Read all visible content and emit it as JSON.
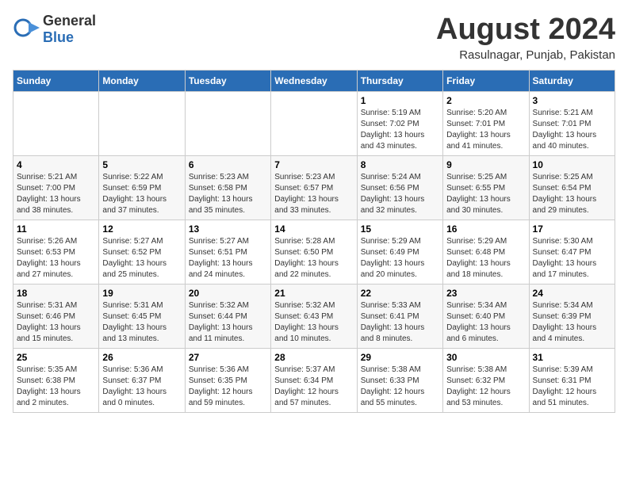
{
  "header": {
    "logo_line1": "General",
    "logo_line2": "Blue",
    "month_title": "August 2024",
    "location": "Rasulnagar, Punjab, Pakistan"
  },
  "calendar": {
    "days_of_week": [
      "Sunday",
      "Monday",
      "Tuesday",
      "Wednesday",
      "Thursday",
      "Friday",
      "Saturday"
    ],
    "weeks": [
      [
        {
          "day": "",
          "info": ""
        },
        {
          "day": "",
          "info": ""
        },
        {
          "day": "",
          "info": ""
        },
        {
          "day": "",
          "info": ""
        },
        {
          "day": "1",
          "info": "Sunrise: 5:19 AM\nSunset: 7:02 PM\nDaylight: 13 hours\nand 43 minutes."
        },
        {
          "day": "2",
          "info": "Sunrise: 5:20 AM\nSunset: 7:01 PM\nDaylight: 13 hours\nand 41 minutes."
        },
        {
          "day": "3",
          "info": "Sunrise: 5:21 AM\nSunset: 7:01 PM\nDaylight: 13 hours\nand 40 minutes."
        }
      ],
      [
        {
          "day": "4",
          "info": "Sunrise: 5:21 AM\nSunset: 7:00 PM\nDaylight: 13 hours\nand 38 minutes."
        },
        {
          "day": "5",
          "info": "Sunrise: 5:22 AM\nSunset: 6:59 PM\nDaylight: 13 hours\nand 37 minutes."
        },
        {
          "day": "6",
          "info": "Sunrise: 5:23 AM\nSunset: 6:58 PM\nDaylight: 13 hours\nand 35 minutes."
        },
        {
          "day": "7",
          "info": "Sunrise: 5:23 AM\nSunset: 6:57 PM\nDaylight: 13 hours\nand 33 minutes."
        },
        {
          "day": "8",
          "info": "Sunrise: 5:24 AM\nSunset: 6:56 PM\nDaylight: 13 hours\nand 32 minutes."
        },
        {
          "day": "9",
          "info": "Sunrise: 5:25 AM\nSunset: 6:55 PM\nDaylight: 13 hours\nand 30 minutes."
        },
        {
          "day": "10",
          "info": "Sunrise: 5:25 AM\nSunset: 6:54 PM\nDaylight: 13 hours\nand 29 minutes."
        }
      ],
      [
        {
          "day": "11",
          "info": "Sunrise: 5:26 AM\nSunset: 6:53 PM\nDaylight: 13 hours\nand 27 minutes."
        },
        {
          "day": "12",
          "info": "Sunrise: 5:27 AM\nSunset: 6:52 PM\nDaylight: 13 hours\nand 25 minutes."
        },
        {
          "day": "13",
          "info": "Sunrise: 5:27 AM\nSunset: 6:51 PM\nDaylight: 13 hours\nand 24 minutes."
        },
        {
          "day": "14",
          "info": "Sunrise: 5:28 AM\nSunset: 6:50 PM\nDaylight: 13 hours\nand 22 minutes."
        },
        {
          "day": "15",
          "info": "Sunrise: 5:29 AM\nSunset: 6:49 PM\nDaylight: 13 hours\nand 20 minutes."
        },
        {
          "day": "16",
          "info": "Sunrise: 5:29 AM\nSunset: 6:48 PM\nDaylight: 13 hours\nand 18 minutes."
        },
        {
          "day": "17",
          "info": "Sunrise: 5:30 AM\nSunset: 6:47 PM\nDaylight: 13 hours\nand 17 minutes."
        }
      ],
      [
        {
          "day": "18",
          "info": "Sunrise: 5:31 AM\nSunset: 6:46 PM\nDaylight: 13 hours\nand 15 minutes."
        },
        {
          "day": "19",
          "info": "Sunrise: 5:31 AM\nSunset: 6:45 PM\nDaylight: 13 hours\nand 13 minutes."
        },
        {
          "day": "20",
          "info": "Sunrise: 5:32 AM\nSunset: 6:44 PM\nDaylight: 13 hours\nand 11 minutes."
        },
        {
          "day": "21",
          "info": "Sunrise: 5:32 AM\nSunset: 6:43 PM\nDaylight: 13 hours\nand 10 minutes."
        },
        {
          "day": "22",
          "info": "Sunrise: 5:33 AM\nSunset: 6:41 PM\nDaylight: 13 hours\nand 8 minutes."
        },
        {
          "day": "23",
          "info": "Sunrise: 5:34 AM\nSunset: 6:40 PM\nDaylight: 13 hours\nand 6 minutes."
        },
        {
          "day": "24",
          "info": "Sunrise: 5:34 AM\nSunset: 6:39 PM\nDaylight: 13 hours\nand 4 minutes."
        }
      ],
      [
        {
          "day": "25",
          "info": "Sunrise: 5:35 AM\nSunset: 6:38 PM\nDaylight: 13 hours\nand 2 minutes."
        },
        {
          "day": "26",
          "info": "Sunrise: 5:36 AM\nSunset: 6:37 PM\nDaylight: 13 hours\nand 0 minutes."
        },
        {
          "day": "27",
          "info": "Sunrise: 5:36 AM\nSunset: 6:35 PM\nDaylight: 12 hours\nand 59 minutes."
        },
        {
          "day": "28",
          "info": "Sunrise: 5:37 AM\nSunset: 6:34 PM\nDaylight: 12 hours\nand 57 minutes."
        },
        {
          "day": "29",
          "info": "Sunrise: 5:38 AM\nSunset: 6:33 PM\nDaylight: 12 hours\nand 55 minutes."
        },
        {
          "day": "30",
          "info": "Sunrise: 5:38 AM\nSunset: 6:32 PM\nDaylight: 12 hours\nand 53 minutes."
        },
        {
          "day": "31",
          "info": "Sunrise: 5:39 AM\nSunset: 6:31 PM\nDaylight: 12 hours\nand 51 minutes."
        }
      ]
    ]
  }
}
